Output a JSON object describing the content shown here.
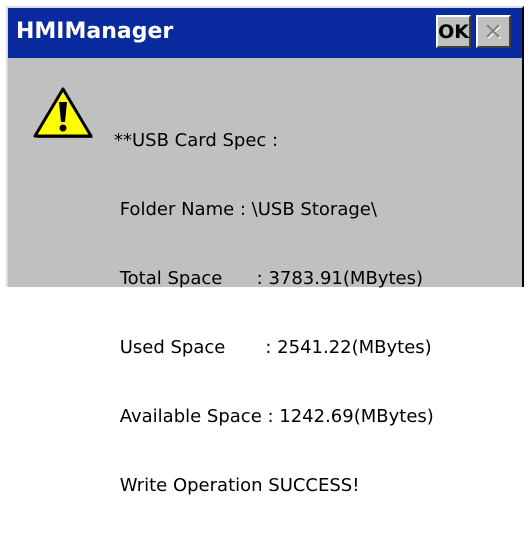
{
  "window": {
    "title": "HMIManager",
    "ok_label": "OK",
    "close_icon": "close-icon"
  },
  "message": {
    "icon": "warning-icon",
    "lines": [
      "**USB Card Spec :",
      " Folder Name : \\USB Storage\\",
      " Total Space      : 3783.91(MBytes)",
      " Used Space       : 2541.22(MBytes)",
      " Available Space : 1242.69(MBytes)",
      " Write Operation SUCCESS!"
    ]
  },
  "colors": {
    "titlebar": "#0a2aa0",
    "title_text": "#ffffff",
    "dialog_bg": "#c0c0c0",
    "warning_fill": "#ffff00"
  }
}
